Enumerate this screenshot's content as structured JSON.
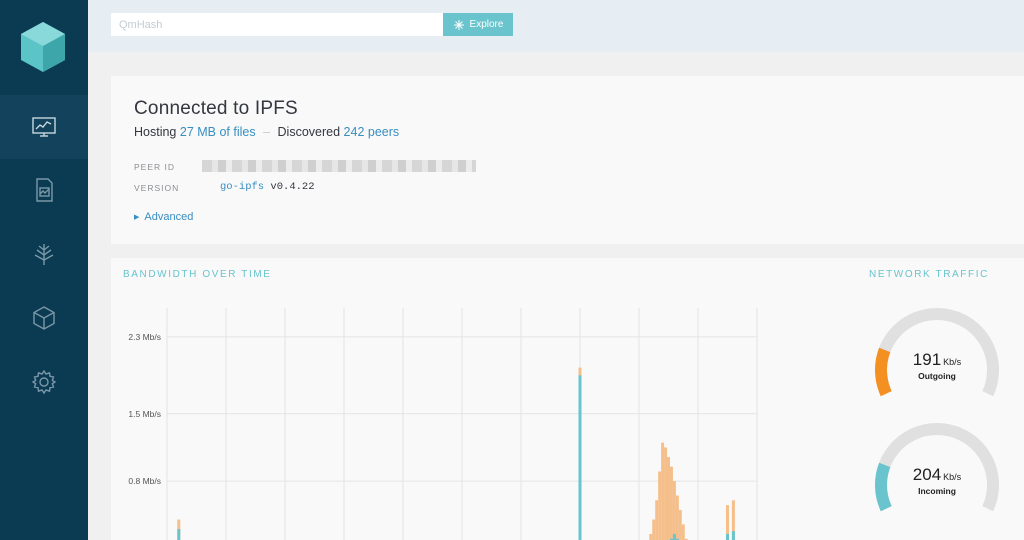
{
  "app": {
    "colors": {
      "sidebar": "#0b3a53",
      "accent_teal": "#69c4cd",
      "accent_orange": "#f39021",
      "link_blue": "#378ec1"
    }
  },
  "sidebar": {
    "items": [
      {
        "name": "status",
        "icon": "monitor-chart-icon",
        "active": true
      },
      {
        "name": "files",
        "icon": "document-chart-icon",
        "active": false
      },
      {
        "name": "peers",
        "icon": "tree-network-icon",
        "active": false
      },
      {
        "name": "explore",
        "icon": "cube-icon",
        "active": false
      },
      {
        "name": "settings",
        "icon": "gear-icon",
        "active": false
      }
    ]
  },
  "search": {
    "placeholder": "QmHash",
    "button_label": "Explore"
  },
  "status": {
    "title": "Connected to IPFS",
    "hosting_label": "Hosting",
    "hosting_value": "27 MB of files",
    "separator": "–",
    "discovered_label": "Discovered",
    "discovered_value": "242 peers",
    "peer_id_label": "PEER ID",
    "version_label": "VERSION",
    "version_name": "go-ipfs",
    "version_number": "v0.4.22",
    "advanced_label": "Advanced"
  },
  "bandwidth": {
    "title": "BANDWIDTH OVER TIME"
  },
  "traffic": {
    "title": "NETWORK TRAFFIC",
    "outgoing": {
      "value": "191",
      "unit": "Kb/s",
      "label": "Outgoing",
      "fill": 0.2
    },
    "incoming": {
      "value": "204",
      "unit": "Kb/s",
      "label": "Incoming",
      "fill": 0.2
    }
  },
  "chart_data": {
    "type": "bar",
    "title": "BANDWIDTH OVER TIME",
    "ylabel": "",
    "ytick_labels": [
      "2.3 Mb/s",
      "1.5 Mb/s",
      "0.8 Mb/s"
    ],
    "yticks": [
      2.3,
      1.5,
      0.8
    ],
    "ylim": [
      0,
      2.6
    ],
    "xlim": [
      0,
      100
    ],
    "grid": true,
    "series": [
      {
        "color": "#69c4cd",
        "points": [
          [
            2,
            0.3
          ],
          [
            44,
            0.05
          ],
          [
            70,
            1.9
          ],
          [
            83.5,
            0.1
          ],
          [
            84,
            0.12
          ],
          [
            84.5,
            0.15
          ],
          [
            85,
            0.18
          ],
          [
            85.5,
            0.2
          ],
          [
            86,
            0.25
          ],
          [
            86.5,
            0.2
          ],
          [
            87,
            0.15
          ],
          [
            87.5,
            0.12
          ],
          [
            88,
            0.1
          ],
          [
            91,
            0.05
          ],
          [
            93,
            0.05
          ],
          [
            95,
            0.25
          ],
          [
            96,
            0.28
          ],
          [
            97,
            0.05
          ],
          [
            98,
            0.05
          ]
        ]
      },
      {
        "color": "#f5bf8c",
        "points": [
          [
            2,
            0.4
          ],
          [
            44,
            0.06
          ],
          [
            70,
            1.98
          ],
          [
            81,
            0.1
          ],
          [
            82,
            0.25
          ],
          [
            82.5,
            0.4
          ],
          [
            83,
            0.6
          ],
          [
            83.5,
            0.9
          ],
          [
            84,
            1.2
          ],
          [
            84.5,
            1.15
          ],
          [
            85,
            1.05
          ],
          [
            85.5,
            0.95
          ],
          [
            86,
            0.8
          ],
          [
            86.5,
            0.65
          ],
          [
            87,
            0.5
          ],
          [
            87.5,
            0.35
          ],
          [
            88,
            0.2
          ],
          [
            88.5,
            0.1
          ],
          [
            91,
            0.06
          ],
          [
            93,
            0.05
          ],
          [
            95,
            0.55
          ],
          [
            96,
            0.6
          ],
          [
            97,
            0.08
          ],
          [
            98,
            0.06
          ]
        ]
      }
    ]
  }
}
